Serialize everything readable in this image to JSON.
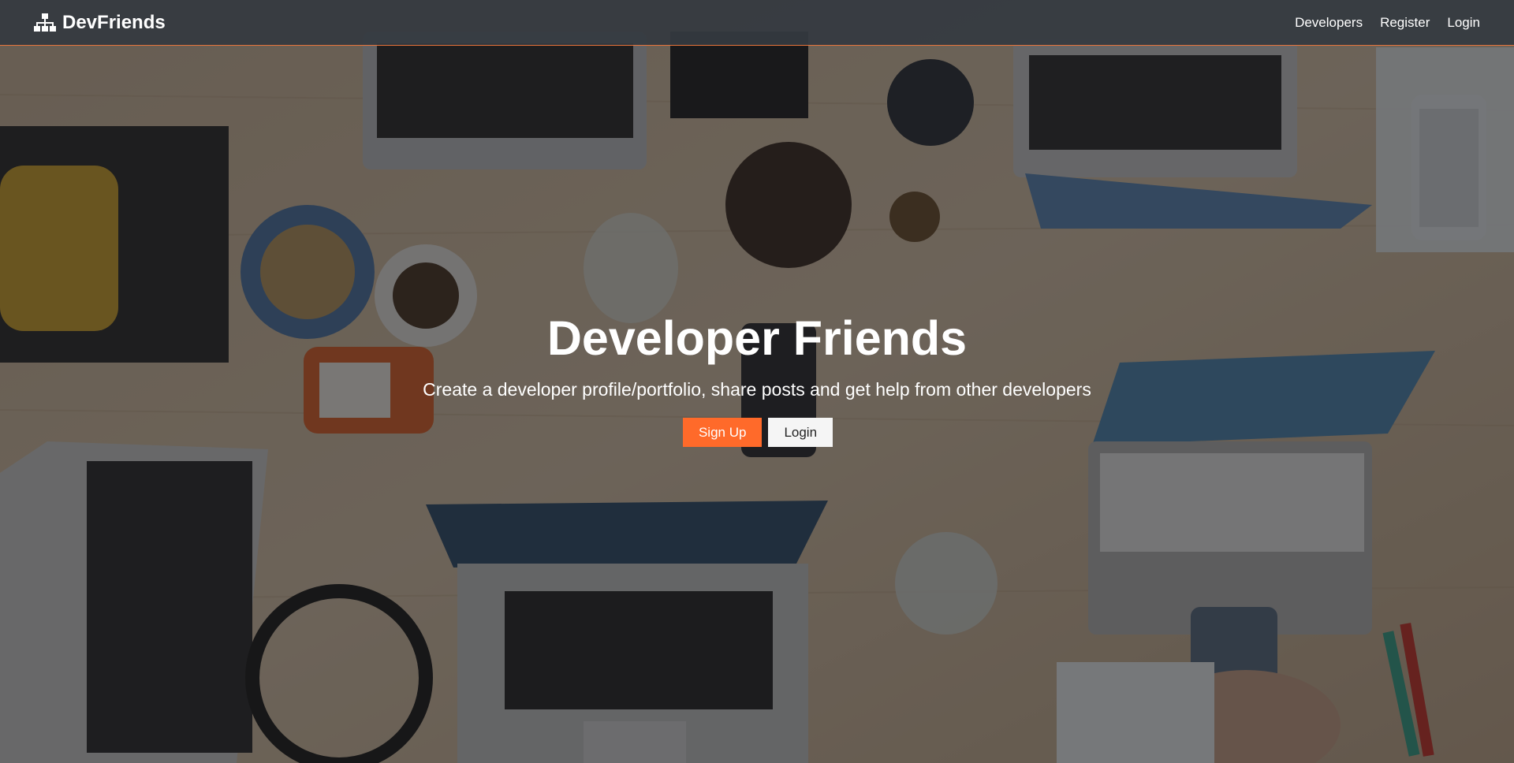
{
  "navbar": {
    "brand_icon": "sitemap-icon",
    "brand_text": "DevFriends",
    "links": [
      {
        "label": "Developers"
      },
      {
        "label": "Register"
      },
      {
        "label": "Login"
      }
    ],
    "accent_color": "#e8743b"
  },
  "hero": {
    "title": "Developer Friends",
    "lead": "Create a developer profile/portfolio, share posts and get help from other developers",
    "signup_label": "Sign Up",
    "login_label": "Login",
    "signup_color": "#ff6a2a",
    "login_color": "#f5f5f5",
    "background": "dimmed photo of developers working at a shared wooden desk with laptops"
  }
}
